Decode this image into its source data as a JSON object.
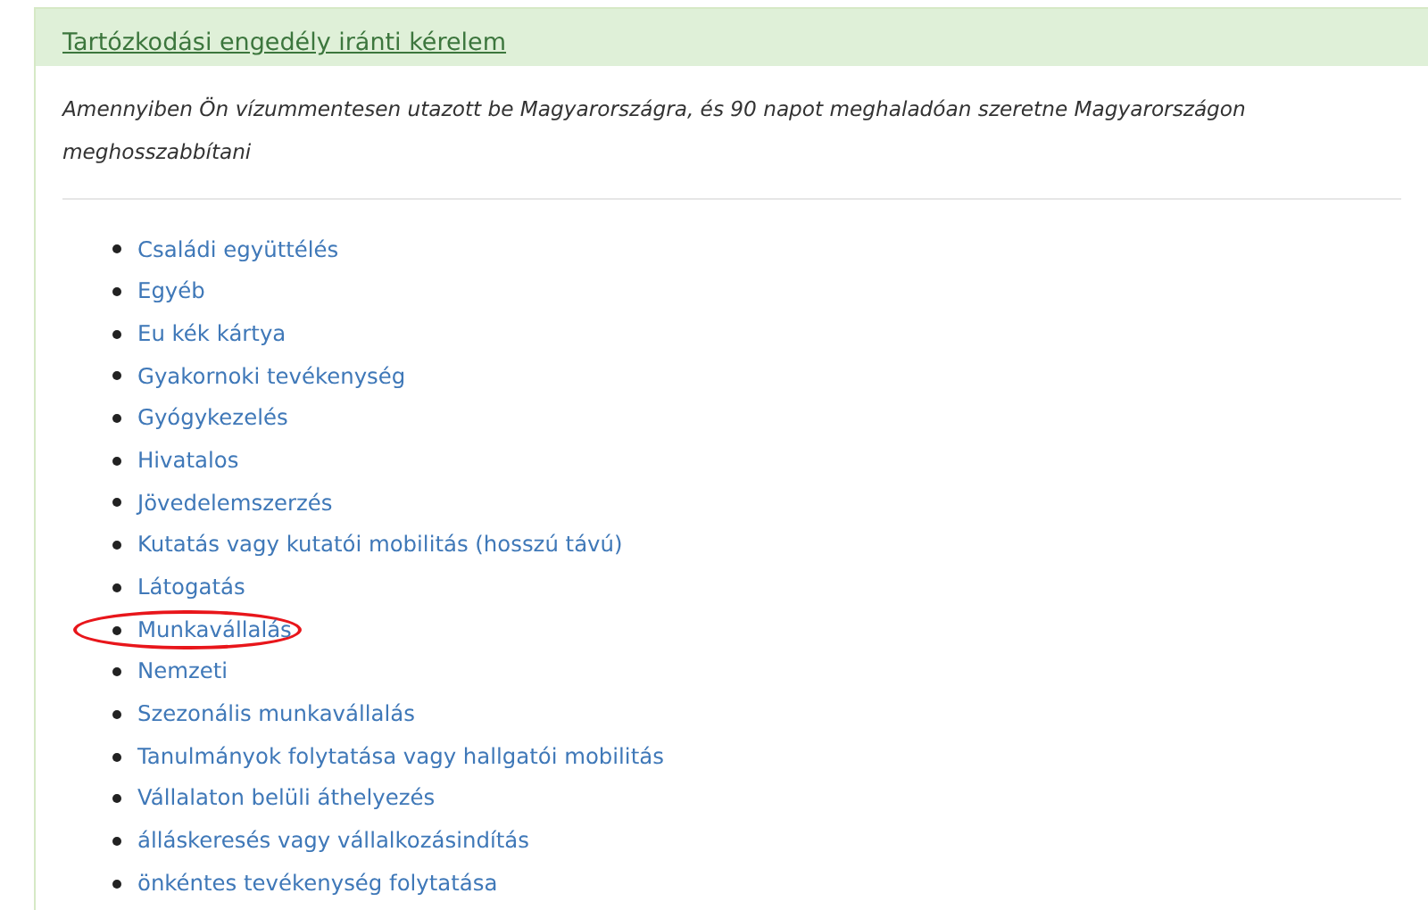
{
  "panel": {
    "title": "Tartózkodási engedély iránti kérelem",
    "intro_lines": [
      "Amennyiben Ön vízummentesen utazott be Magyarországra, és 90 napot meghaladóan szeretne Magyarországon",
      "meghosszabbítani"
    ],
    "items": [
      {
        "label": "Családi együttélés",
        "highlighted": false
      },
      {
        "label": "Egyéb",
        "highlighted": false
      },
      {
        "label": "Eu kék kártya",
        "highlighted": false
      },
      {
        "label": "Gyakornoki tevékenység",
        "highlighted": false
      },
      {
        "label": "Gyógykezelés",
        "highlighted": false
      },
      {
        "label": "Hivatalos",
        "highlighted": false
      },
      {
        "label": "Jövedelemszerzés",
        "highlighted": false
      },
      {
        "label": "Kutatás vagy kutatói mobilitás (hosszú távú)",
        "highlighted": false
      },
      {
        "label": "Látogatás",
        "highlighted": false
      },
      {
        "label": "Munkavállalás",
        "highlighted": true
      },
      {
        "label": "Nemzeti",
        "highlighted": false
      },
      {
        "label": "Szezonális munkavállalás",
        "highlighted": false
      },
      {
        "label": "Tanulmányok folytatása vagy hallgatói mobilitás",
        "highlighted": false
      },
      {
        "label": "Vállalaton belüli áthelyezés",
        "highlighted": false
      },
      {
        "label": "álláskeresés vagy vállalkozásindítás",
        "highlighted": false
      },
      {
        "label": "önkéntes tevékenység folytatása",
        "highlighted": false
      }
    ]
  }
}
